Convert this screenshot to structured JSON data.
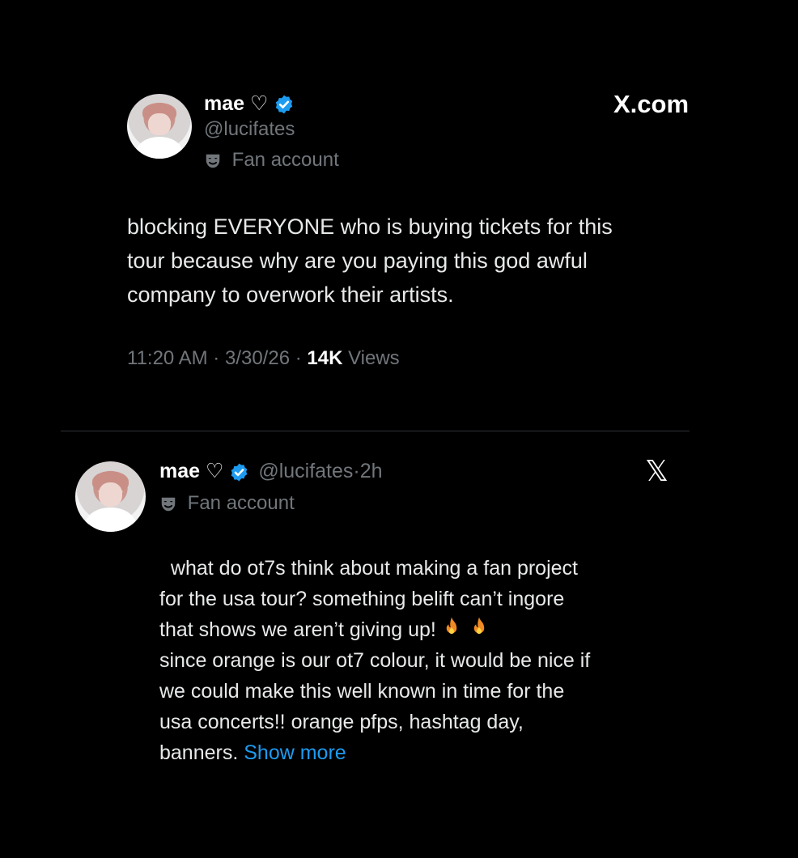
{
  "tweet1": {
    "display_name": "mae ♡",
    "handle": "@lucifates",
    "label": "Fan account",
    "site": "X.com",
    "text": "blocking EVERYONE who is buying tickets for this\ntour because why are you paying this god awful\ncompany to overwork their artists.",
    "time": "11:20 AM",
    "date": "3/30/26",
    "views_count": "14K",
    "views_label": "Views",
    "sep": "·"
  },
  "tweet2": {
    "display_name": "mae ♡",
    "handle": "@lucifates",
    "age": "2h",
    "sep": "·",
    "label": "Fan account",
    "para1": "what do ot7s think about making a fan project\nfor the usa tour? something belift can’t ingore\nthat shows we aren’t giving up!",
    "para2": "since orange is our ot7 colour, it would be nice if\nwe could make this well known in time for the\nusa concerts!! orange pfps, hashtag day,",
    "para2_last": "banners.",
    "show_more": "Show more",
    "x_logo": "𝕏"
  },
  "icons": {
    "verified": "verified-badge-icon",
    "fan": "mask-icon",
    "fire": "fire-icon"
  },
  "colors": {
    "background": "#000000",
    "verified": "#1d9bf0",
    "muted": "#71767b",
    "link": "#1d9bf0"
  }
}
